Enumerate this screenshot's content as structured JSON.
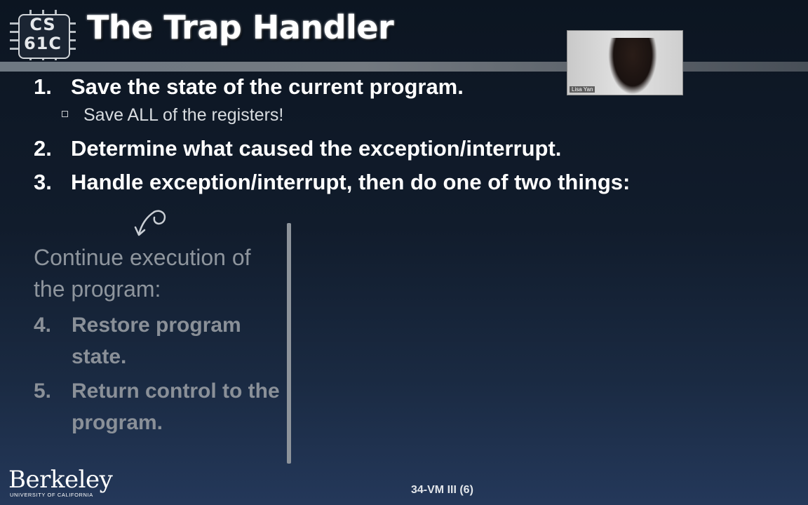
{
  "logo": {
    "line1": "CS",
    "line2": "61C"
  },
  "title": "The Trap Handler",
  "video": {
    "participant_name": "Lisa Yan"
  },
  "steps": [
    {
      "number": "1.",
      "text": "Save the state of the current program."
    },
    {
      "number": "2.",
      "text": "Determine what caused the exception/interrupt."
    },
    {
      "number": "3.",
      "text": "Handle exception/interrupt, then do one of two things:"
    }
  ],
  "sub_bullet": "Save ALL of the registers!",
  "left_column": {
    "heading": "Continue execution of the program:",
    "steps": [
      {
        "number": "4.",
        "text": "Restore program state."
      },
      {
        "number": "5.",
        "text": "Return control to the program."
      }
    ]
  },
  "footer": {
    "institution": "Berkeley",
    "institution_sub": "UNIVERSITY OF CALIFORNIA",
    "slide_ref": "34-VM III (6)"
  },
  "colors": {
    "background": "#111c2c",
    "active_text": "#ffffff",
    "faded_text": "#8e959d"
  }
}
